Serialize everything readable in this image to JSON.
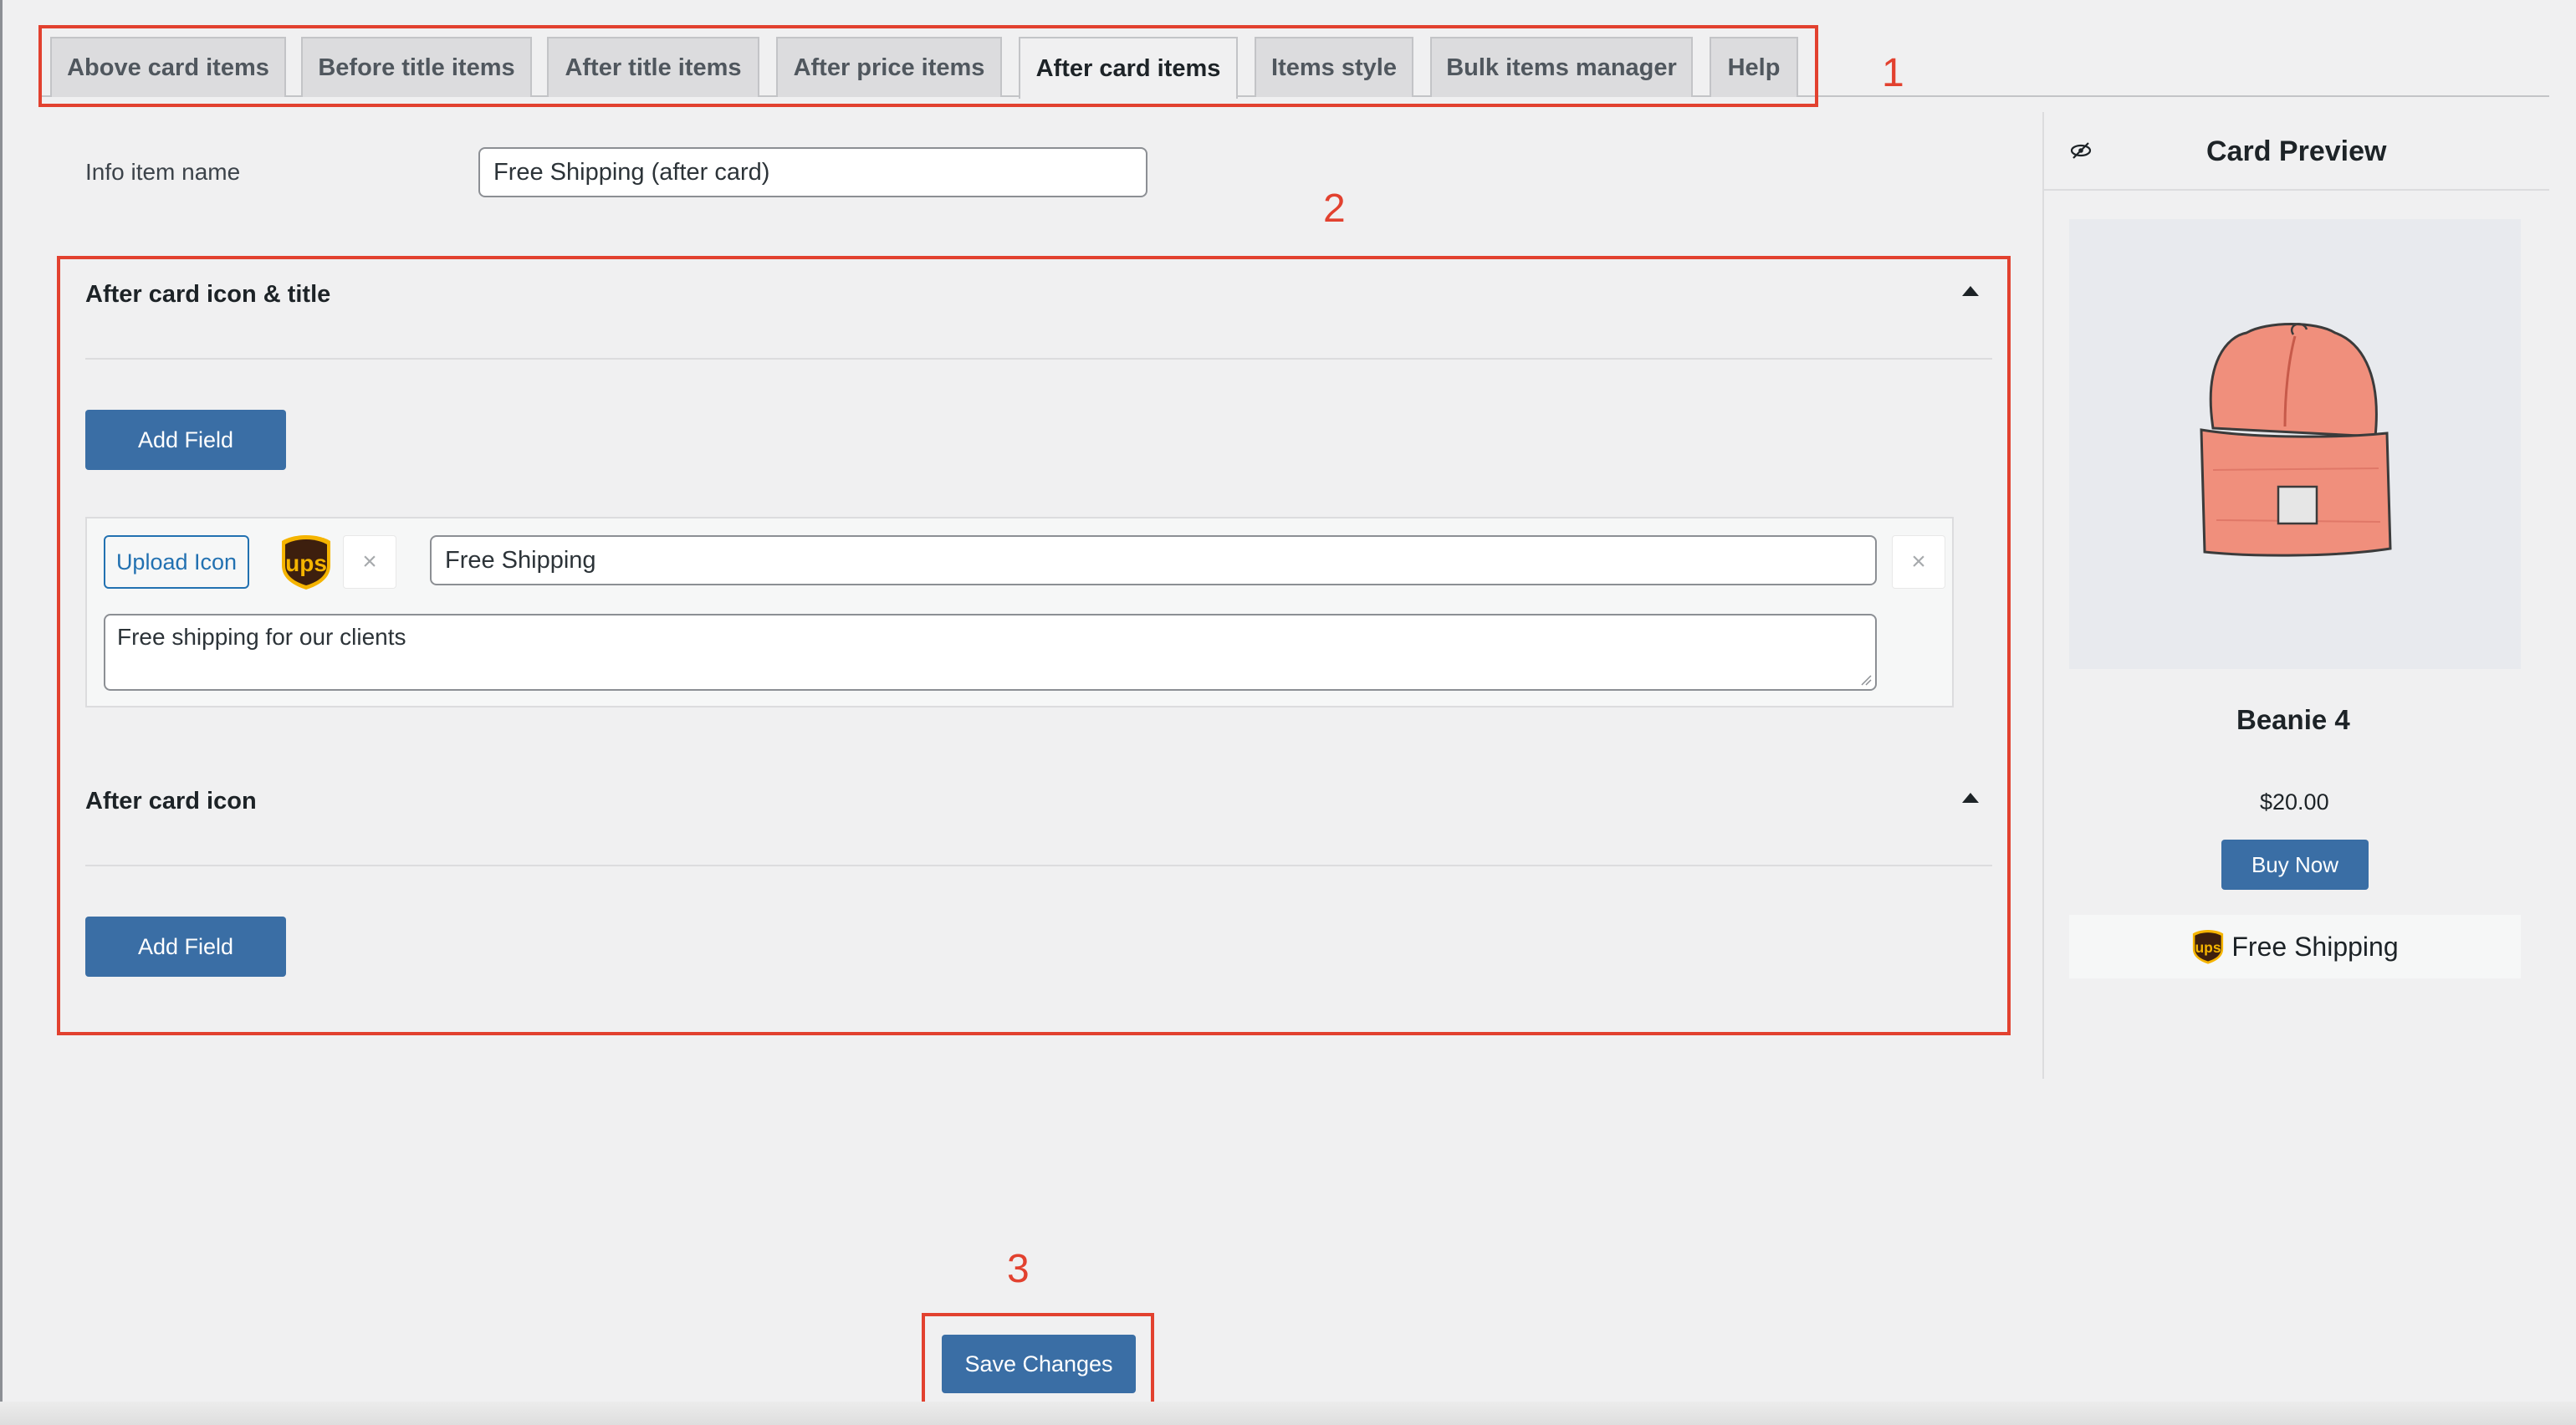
{
  "tabs": [
    {
      "label": "Above card items"
    },
    {
      "label": "Before title items"
    },
    {
      "label": "After title items"
    },
    {
      "label": "After price items"
    },
    {
      "label": "After card items",
      "active": true
    },
    {
      "label": "Items style"
    },
    {
      "label": "Bulk items manager"
    },
    {
      "label": "Help"
    }
  ],
  "annotations": {
    "one": "1",
    "two": "2",
    "three": "3"
  },
  "info_item": {
    "label": "Info item name",
    "value": "Free Shipping (after card)"
  },
  "section_icon_title": {
    "title": "After card icon & title",
    "add_field_label": "Add Field",
    "field": {
      "upload_label": "Upload Icon",
      "icon": "ups-logo-icon",
      "remove_icon_glyph": "×",
      "title_value": "Free Shipping",
      "remove_field_glyph": "×",
      "description_value": "Free shipping for our clients"
    }
  },
  "section_icon": {
    "title": "After card icon",
    "add_field_label": "Add Field"
  },
  "preview": {
    "heading": "Card Preview",
    "visibility_icon": "eye-slash-icon",
    "product_image": "beanie-image",
    "product_title": "Beanie 4",
    "price": "$20.00",
    "buy_label": "Buy Now",
    "shipping_text": "Free Shipping"
  },
  "save_label": "Save Changes",
  "colors": {
    "primary": "#3a6ea5",
    "link": "#2271b1",
    "annotation": "#e2412f"
  }
}
